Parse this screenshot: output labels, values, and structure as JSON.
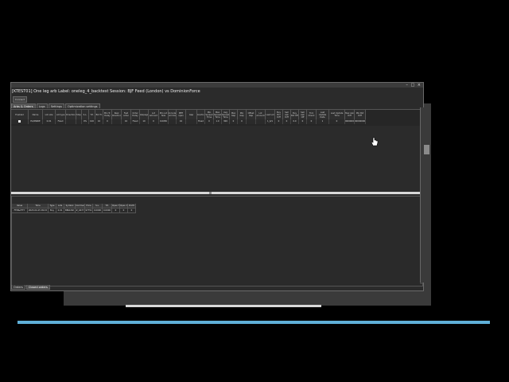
{
  "window": {
    "title": "[KTEST01] One leg arb Label: oneleg_4_backtest Session: BJF Feed (London) vs DominionForce",
    "controls": "– □ ×",
    "small_button": "Connect"
  },
  "tabs": [
    {
      "label": "Arbs & Orders",
      "active": true
    },
    {
      "label": "Logs",
      "active": false
    },
    {
      "label": "Settings",
      "active": false
    },
    {
      "label": "Optimization settings",
      "active": false
    }
  ],
  "grid": {
    "headers": [
      "Enabled",
      "Name",
      "Lot size",
      "Lot type",
      "Direction",
      "Stop",
      "S.L.",
      "T.P.",
      "Bid Tr.",
      "Min Tr. Delay",
      "Real Direction",
      "Fast order",
      "Order Delay",
      "Slippage",
      "Lot Amount",
      "Min Lot Size",
      "Include Commiss.",
      "MFE open",
      "Gap",
      "Direction",
      "Min Spread Time",
      "Max Spread Time",
      "Avg Spread Time",
      "Max Gap",
      "Min Gap",
      "Offset Gap",
      "Lot Amount",
      "Last Lot",
      "Buy Bid Diff",
      "Sell Ask Diff",
      "Buy Bid Off",
      "Sell Ask Off",
      "Tick Check",
      "Last Update Date",
      "Last Update Time",
      "Max Ask Diff",
      "Min Bid Diff"
    ],
    "row": [
      "",
      "EA/NWRE",
      "0.01",
      "Fixed",
      "",
      "",
      "0%",
      "100",
      "10",
      "0",
      "",
      "10",
      "Fixed",
      "10",
      "0",
      "0.0050",
      "",
      "10",
      "",
      "Fixed",
      "0",
      "1.0",
      "300",
      "0",
      "0",
      "",
      "",
      "1_4/1",
      "0",
      "0",
      "0.0",
      "0",
      "0",
      "1",
      "0",
      "0000000000",
      "000000000"
    ]
  },
  "lower_table": {
    "headers": [
      "Value",
      "Time",
      "Type",
      "Lots",
      "Symbol",
      "Comment",
      "Price",
      "S.L.",
      "T.P.",
      "Open Time",
      "Open Date",
      "Profit"
    ],
    "row": [
      "FFM&VTTY",
      "2023-04-15 09:15",
      "Buy",
      "0.01",
      "BBGUSD",
      "#_4677",
      "97751",
      "0.0000",
      "0.0000",
      "0",
      "0",
      "0"
    ]
  },
  "bottom_tabs": [
    {
      "label": "Orders",
      "active": false
    },
    {
      "label": "Closed orders",
      "active": true
    }
  ],
  "colors": {
    "accent": "#5fb0d8",
    "window_bg": "#2b2b2b",
    "splitter": "#d8d8d8"
  },
  "icons": {
    "cursor": "hand-pointer-icon"
  }
}
